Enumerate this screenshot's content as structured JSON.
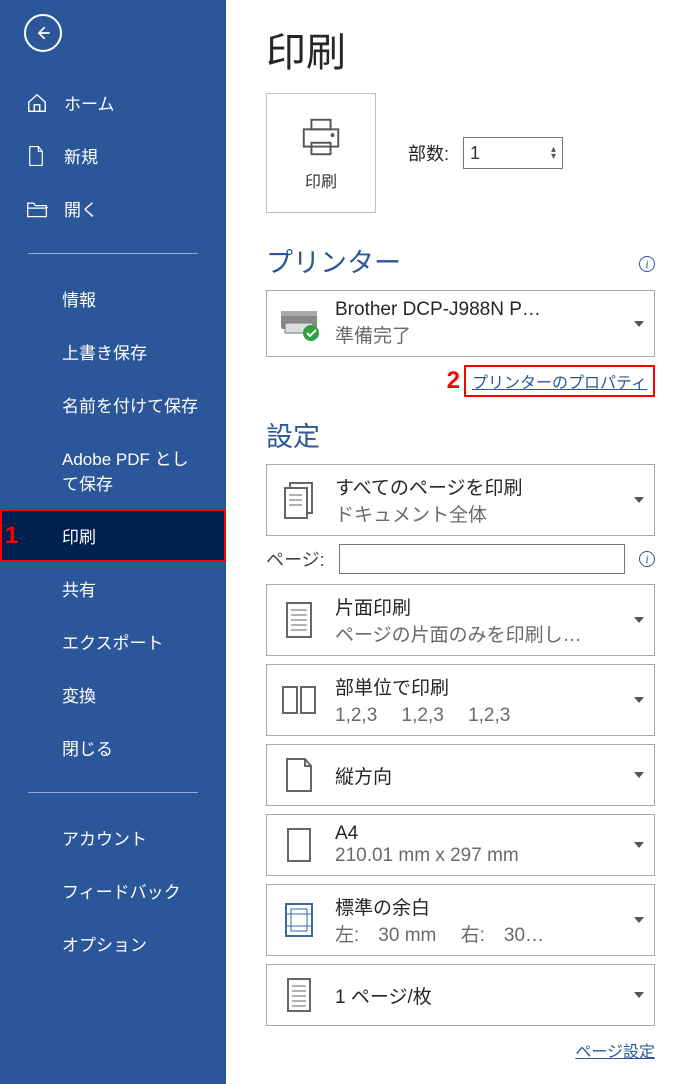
{
  "title": "印刷",
  "sidebar": {
    "home": "ホーム",
    "new": "新規",
    "open": "開く",
    "info": "情報",
    "save": "上書き保存",
    "saveas": "名前を付けて保存",
    "adobepdf": "Adobe PDF として保存",
    "print": "印刷",
    "share": "共有",
    "export": "エクスポート",
    "convert": "変換",
    "close": "閉じる",
    "account": "アカウント",
    "feedback": "フィードバック",
    "options": "オプション"
  },
  "print_card_label": "印刷",
  "copies_label": "部数:",
  "copies_value": "1",
  "printer_section": "プリンター",
  "printer": {
    "name": "Brother DCP-J988N P…",
    "status": "準備完了"
  },
  "printer_props_link": "プリンターのプロパティ",
  "settings_section": "設定",
  "settings": {
    "range": {
      "t": "すべてのページを印刷",
      "s": "ドキュメント全体"
    },
    "pages_label": "ページ:",
    "side": {
      "t": "片面印刷",
      "s": "ページの片面のみを印刷し…"
    },
    "collate": {
      "t": "部単位で印刷",
      "s": "1,2,3　 1,2,3　 1,2,3"
    },
    "orient": {
      "t": "縦方向"
    },
    "paper": {
      "t": "A4",
      "s": "210.01 mm x 297 mm"
    },
    "margin": {
      "t": "標準の余白",
      "s": "左:　30 mm　 右:　30…"
    },
    "sheet": {
      "t": "1 ページ/枚"
    }
  },
  "page_setup_link": "ページ設定",
  "annot": {
    "n1": "1",
    "n2": "2"
  }
}
